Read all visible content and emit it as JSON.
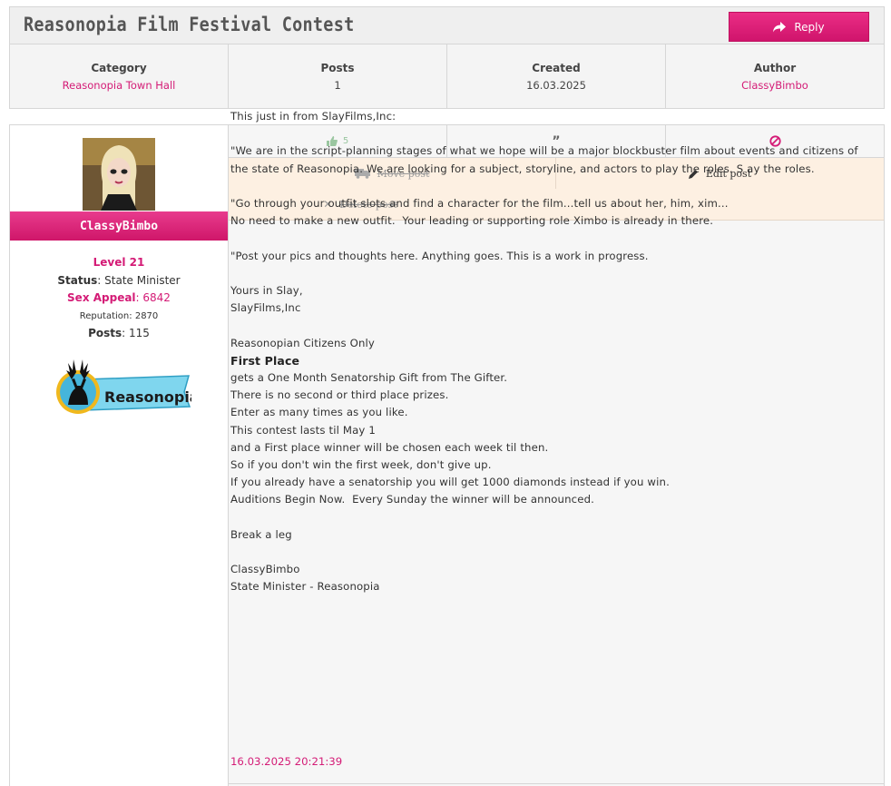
{
  "thread": {
    "title": "Reasonopia Film Festival Contest",
    "reply_label": "Reply"
  },
  "stats": [
    {
      "label": "Category",
      "value": "Reasonopia Town Hall"
    },
    {
      "label": "Posts",
      "value": "1"
    },
    {
      "label": "Created",
      "value": "16.03.2025"
    },
    {
      "label": "Author",
      "value": "ClassyBimbo"
    }
  ],
  "user": {
    "name": "ClassyBimbo",
    "level": "Level 21",
    "status_label": "Status",
    "status_value": "State Minister",
    "sex_appeal_label": "Sex Appeal",
    "sex_appeal_value": "6842",
    "reputation_label": "Reputation:",
    "reputation_value": "2870",
    "posts_label": "Posts",
    "posts_value": "115",
    "badge_text": "Reasonopia"
  },
  "actions": {
    "like_count": "5",
    "move_label": "Move post",
    "edit_label": "Edit post",
    "delete_label": "Delete post"
  },
  "post": {
    "lines": [
      "This just in from SlayFilms,Inc:",
      "",
      "\"We are in the script-planning stages of what we hope will be a major blockbuster film about events and citizens of the state of Reasonopia. We are looking for a subject, storyline, and actors to play the roles. S ay the roles.",
      "",
      "\"Go through your outfit slots and find a character for the film...tell us about her, him, xim...\nNo need to make a new outfit.  Your leading or supporting role Ximbo is already in there.",
      "",
      "\"Post your pics and thoughts here. Anything goes. This is a work in progress.",
      "",
      "Yours in Slay,\nSlayFilms,Inc",
      "",
      "Reasonopian Citizens Only"
    ],
    "bold_line": "First Place",
    "lines2": [
      "gets a One Month Senatorship Gift from The Gifter.\nThere is no second or third place prizes.\nEnter as many times as you like.\nThis contest lasts til May 1\nand a First place winner will be chosen each week til then.\nSo if you don't win the first week, don't give up.\nIf you already have a senatorship you will get 1000 diamonds instead if you win.\nAuditions Begin Now.  Every Sunday the winner will be announced.",
      "",
      "Break a leg",
      "",
      "ClassyBimbo\nState Minister - Reasonopia"
    ],
    "timestamp": "16.03.2025 20:21:39"
  },
  "colors": {
    "accent": "#d41b76",
    "panel": "#f4f4f4",
    "border": "#d6d6d6",
    "action_bg": "#fdf0e2"
  }
}
